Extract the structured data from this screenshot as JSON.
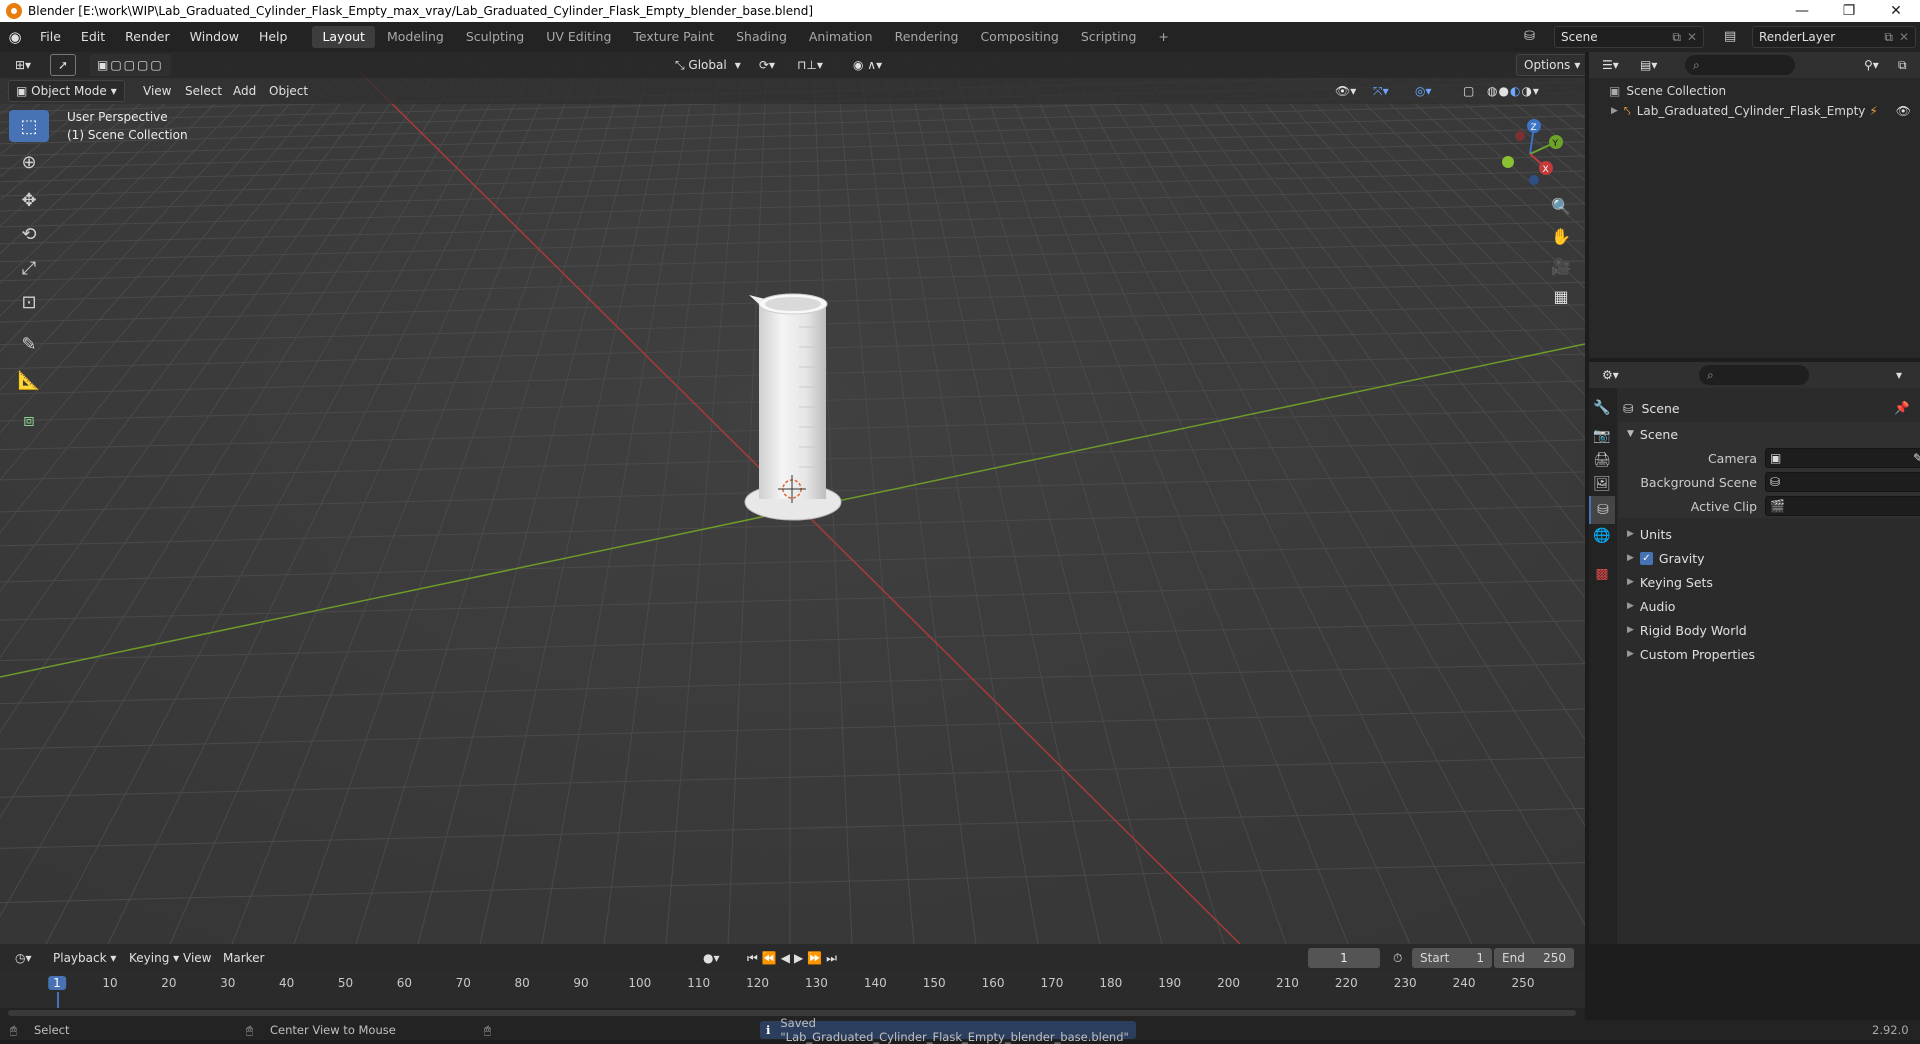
{
  "window": {
    "title": "Blender [E:\\work\\WIP\\Lab_Graduated_Cylinder_Flask_Empty_max_vray/Lab_Graduated_Cylinder_Flask_Empty_blender_base.blend]",
    "minimize": "—",
    "restore": "❐",
    "close": "✕"
  },
  "menubar": {
    "menus": [
      "File",
      "Edit",
      "Render",
      "Window",
      "Help"
    ],
    "workspaces": [
      "Layout",
      "Modeling",
      "Sculpting",
      "UV Editing",
      "Texture Paint",
      "Shading",
      "Animation",
      "Rendering",
      "Compositing",
      "Scripting"
    ],
    "active_workspace": "Layout",
    "add_workspace": "+",
    "scene_label": "Scene",
    "render_layer_label": "RenderLayer"
  },
  "viewport": {
    "transform_orientation": "Global",
    "options_label": "Options",
    "mode": "Object Mode",
    "menus": [
      "View",
      "Select",
      "Add",
      "Object"
    ],
    "overlay_line1": "User Perspective",
    "overlay_line2": "(1) Scene Collection",
    "gizmo": {
      "z": "Z",
      "y": "Y",
      "x": "X"
    }
  },
  "outliner": {
    "root": "Scene Collection",
    "items": [
      {
        "label": "Lab_Graduated_Cylinder_Flask_Empty"
      }
    ]
  },
  "properties": {
    "context_label": "Scene",
    "panel_title": "Scene",
    "fields": [
      {
        "label": "Camera",
        "value": ""
      },
      {
        "label": "Background Scene",
        "value": ""
      },
      {
        "label": "Active Clip",
        "value": ""
      }
    ],
    "subpanels": [
      "Units",
      "Gravity",
      "Keying Sets",
      "Audio",
      "Rigid Body World",
      "Custom Properties"
    ],
    "gravity_checked": true
  },
  "timeline": {
    "menus": [
      "Playback",
      "Keying",
      "View",
      "Marker"
    ],
    "current_frame": "1",
    "start_label": "Start",
    "start_value": "1",
    "end_label": "End",
    "end_value": "250",
    "ticks": [
      "1",
      "10",
      "20",
      "30",
      "40",
      "50",
      "60",
      "70",
      "80",
      "90",
      "100",
      "110",
      "120",
      "130",
      "140",
      "150",
      "160",
      "170",
      "180",
      "190",
      "200",
      "210",
      "220",
      "230",
      "240",
      "250"
    ]
  },
  "statusbar": {
    "left_hint": "Select",
    "middle_hint": "Center View to Mouse",
    "message": "Saved \"Lab_Graduated_Cylinder_Flask_Empty_blender_base.blend\"",
    "version": "2.92.0"
  },
  "colors": {
    "accent": "#4772b3",
    "x_axis": "#a83a3a",
    "y_axis": "#6e9a2a",
    "orange": "#e87d0d"
  }
}
